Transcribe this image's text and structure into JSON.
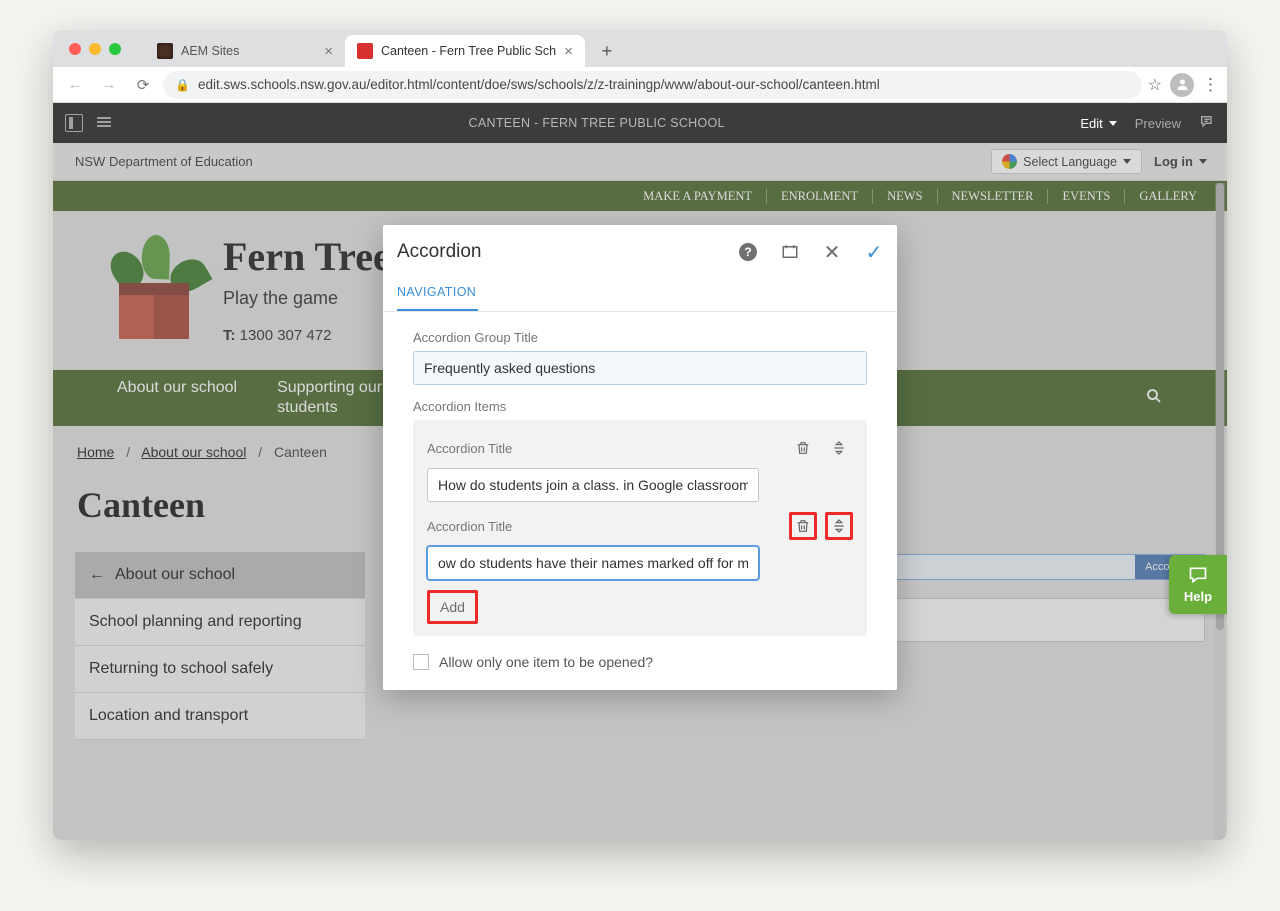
{
  "browser": {
    "tabs": [
      {
        "title": "AEM Sites"
      },
      {
        "title": "Canteen - Fern Tree Public Sch"
      }
    ],
    "url": "edit.sws.schools.nsw.gov.au/editor.html/content/doe/sws/schools/z/z-trainingp/www/about-our-school/canteen.html"
  },
  "aem": {
    "title": "CANTEEN - FERN TREE PUBLIC SCHOOL",
    "mode": "Edit",
    "preview": "Preview"
  },
  "gov_strip": {
    "dept": "NSW Department of Education",
    "lang_label": "Select Language",
    "login": "Log in"
  },
  "top_nav": [
    "MAKE A PAYMENT",
    "ENROLMENT",
    "NEWS",
    "NEWSLETTER",
    "EVENTS",
    "GALLERY"
  ],
  "school": {
    "name": "Fern Tree",
    "tagline": "Play the game",
    "phone_label": "T:",
    "phone": "1300 307 472"
  },
  "main_nav": {
    "item1": "About our school",
    "item2": "Supporting our\nstudents"
  },
  "breadcrumb": {
    "home": "Home",
    "about": "About our school",
    "canteen": "Canteen"
  },
  "page_title": "Canteen",
  "sidenav": {
    "active": "About our school",
    "items": [
      "School planning and reporting",
      "Returning to school safely",
      "Location and transport"
    ]
  },
  "accordion_zone": {
    "tag": "Accordion"
  },
  "help": {
    "label": "Help"
  },
  "dialog": {
    "title": "Accordion",
    "tab": "NAVIGATION",
    "group_label": "Accordion Group Title",
    "group_value": "Frequently asked questions",
    "items_label": "Accordion Items",
    "items": [
      {
        "label": "Accordion Title",
        "value": "How do students join a class. in Google classroom?"
      },
      {
        "label": "Accordion Title",
        "value": "ow do students have their names marked off for morning roll call?"
      }
    ],
    "add": "Add",
    "allow_one": "Allow only one item to be opened?"
  }
}
